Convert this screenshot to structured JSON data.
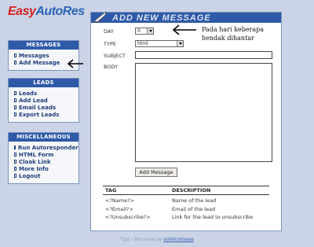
{
  "logo": {
    "part1": "Easy",
    "part2": "AutoRes"
  },
  "sidebar": {
    "sections": [
      {
        "title": "MESSAGES",
        "items": [
          "Messages",
          "Add Message"
        ]
      },
      {
        "title": "LEADS",
        "items": [
          "Leads",
          "Add Lead",
          "Email Leads",
          "Export Leads"
        ]
      },
      {
        "title": "MISCELLANEOUS",
        "items": [
          "Run Autoresponder",
          "HTML Form",
          "Cloak Link",
          "More Info",
          "Logout"
        ]
      }
    ]
  },
  "main": {
    "title": "ADD NEW MESSAGE",
    "form": {
      "day_label": "DAY",
      "day_value": "0",
      "type_label": "TYPE",
      "type_value": "html",
      "subject_label": "SUBJECT",
      "subject_value": "",
      "body_label": "BODY",
      "body_value": "",
      "submit_label": "Add Message"
    },
    "tags": {
      "headers": [
        "TAG",
        "DESCRIPTION"
      ],
      "rows": [
        [
          "<?Name?>",
          "Name of the lead"
        ],
        [
          "<?Email?>",
          "Email of the lead"
        ],
        [
          "<?Unsubscribe?>",
          "Link for the lead to unsubscribe"
        ]
      ]
    }
  },
  "annotation": {
    "line1": "Pada hari keberapa",
    "line2": "hendak dihantar"
  },
  "footer": {
    "prefix": "Tips - Percuma by",
    "link": "solehzolyaas"
  },
  "colors": {
    "header_blue": "#2f5aa8",
    "logo_red": "#d61f1f",
    "logo_blue": "#2a63b8"
  }
}
